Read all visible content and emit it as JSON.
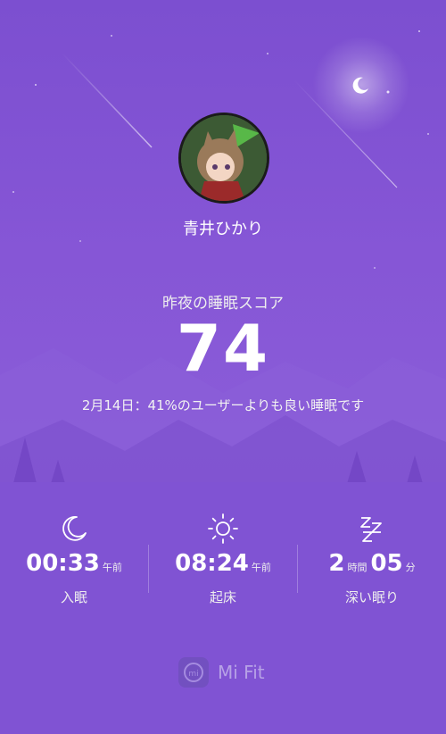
{
  "user": {
    "name": "青井ひかり"
  },
  "score": {
    "label": "昨夜の睡眠スコア",
    "value": "74"
  },
  "summary": "2月14日：41%のユーザーよりも良い睡眠です",
  "stats": [
    {
      "icon": "moon-icon",
      "value": "00:33",
      "unit": "午前",
      "label": "入眠"
    },
    {
      "icon": "sun-icon",
      "value": "08:24",
      "unit": "午前",
      "label": "起床"
    },
    {
      "icon": "zzz-icon",
      "hours": "2",
      "hours_unit": "時間",
      "minutes": "05",
      "minutes_unit": "分",
      "label": "深い眠り"
    }
  ],
  "brand": {
    "name": "Mi Fit",
    "logo_text": "mi"
  },
  "colors": {
    "background": "#8656d6",
    "accent": "#ffffff"
  }
}
